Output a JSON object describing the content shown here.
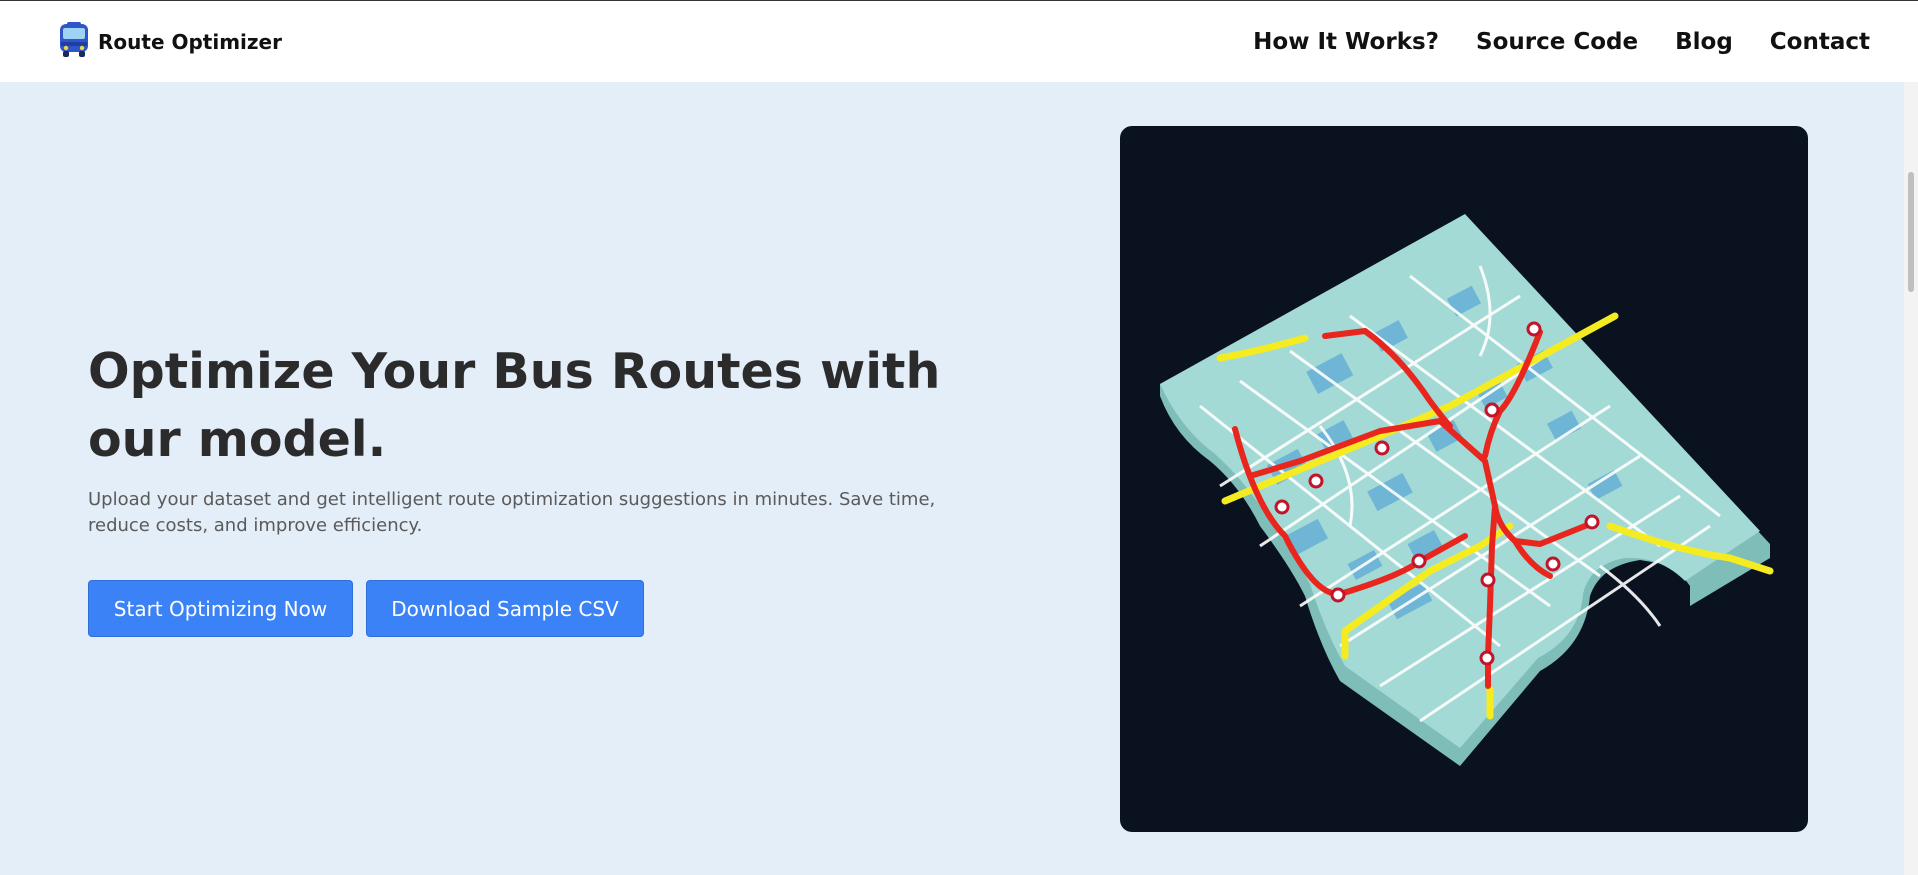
{
  "header": {
    "brand_name": "Route Optimizer",
    "brand_icon": "bus-icon",
    "nav": [
      {
        "label": "How It Works?"
      },
      {
        "label": "Source Code"
      },
      {
        "label": "Blog"
      },
      {
        "label": "Contact"
      }
    ]
  },
  "hero": {
    "title": "Optimize Your Bus Routes with our model.",
    "subtitle": "Upload your dataset and get intelligent route optimization suggestions in minutes. Save time, reduce costs, and improve efficiency.",
    "primary_button": "Start Optimizing Now",
    "secondary_button": "Download Sample CSV",
    "image": "isometric-city-route-map"
  },
  "colors": {
    "page_bg": "#e3eef9",
    "header_bg": "#ffffff",
    "accent": "#3b82f6",
    "map_bg": "#0a1220",
    "route_red": "#e8261d",
    "route_yellow": "#f4ec21",
    "map_land": "#a3dad6"
  }
}
